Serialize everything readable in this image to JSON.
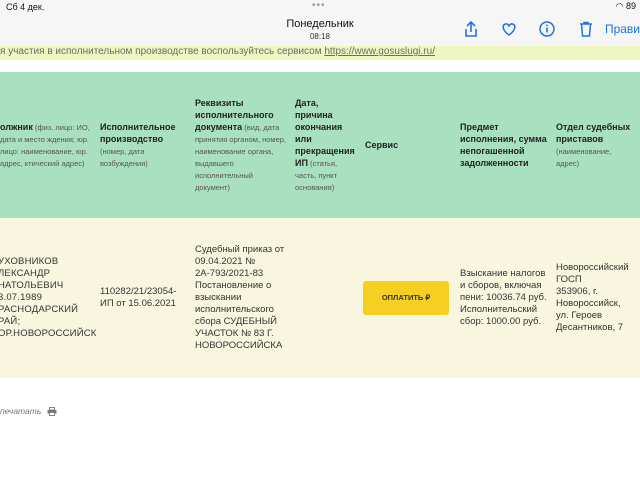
{
  "status_bar": {
    "time_date": "Сб 4 дек.",
    "battery": "89"
  },
  "nav": {
    "title": "Понедельник",
    "subtitle": "08:18",
    "right_link": "Прави"
  },
  "notice": {
    "text": "я участия в исполнительном производстве воспользуйтесь сервисом ",
    "link": "https://www.gosuslugi.ru/"
  },
  "table": {
    "headers": {
      "debtor": {
        "title": "олжник",
        "sub": " (физ. лицо: ИО, дата и место ждения; юр. лицо: наименование, юр. адрес, ктический адрес)"
      },
      "proceeding": {
        "title": "Исполнительное производство",
        "sub": " (номер, дата возбуждения)"
      },
      "document": {
        "title": "Реквизиты исполнительного документа",
        "sub": " (вид, дата принятия органом, номер, наименование органа, выдавшего исполнительный документ)"
      },
      "end_date": {
        "title": "Дата, причина окончания или прекращения ИП",
        "sub": " (статья, часть, пункт основания)"
      },
      "service": {
        "title": "Сервис"
      },
      "subject": {
        "title": "Предмет исполнения, сумма непогашенной задолженности"
      },
      "department": {
        "title": "Отдел судебных приставов",
        "sub": " (наименование, адрес)"
      }
    },
    "row": {
      "debtor": [
        "УХОВНИКОВ",
        "ЛЕКСАНДР",
        "НАТОЛЬЕВИЧ",
        "3.07.1989",
        "РАСНОДАРСКИЙ",
        "РАЙ;",
        "ОР.НОВОРОССИЙСК"
      ],
      "proceeding": "110282/21/23054-ИП от 15.06.2021",
      "document": "Судебный приказ от 09.04.2021 № 2А-793/2021-83 Постановление о взыскании исполнительского сбора СУДЕБНЫЙ УЧАСТОК № 83 Г. НОВОРОССИЙСКА",
      "end_date": "",
      "pay_button": "ОПЛАТИТЬ ₽",
      "subject": "Взыскание налогов и сборов, включая пени: 10036.74 руб. Исполнительский сбор: 1000.00 руб.",
      "department": [
        "Новороссийский",
        "ГОСП",
        "353906, г.",
        "Новороссийск,",
        "ул. Героев",
        "Десантников, 7"
      ]
    }
  },
  "print_label": "печатать",
  "colors": {
    "header_bg": "#a9e0bf",
    "row_bg": "#f8f6df",
    "notice_bg": "#eef7c0",
    "pay_button": "#f5d020",
    "ios_blue": "#1a73e8"
  }
}
